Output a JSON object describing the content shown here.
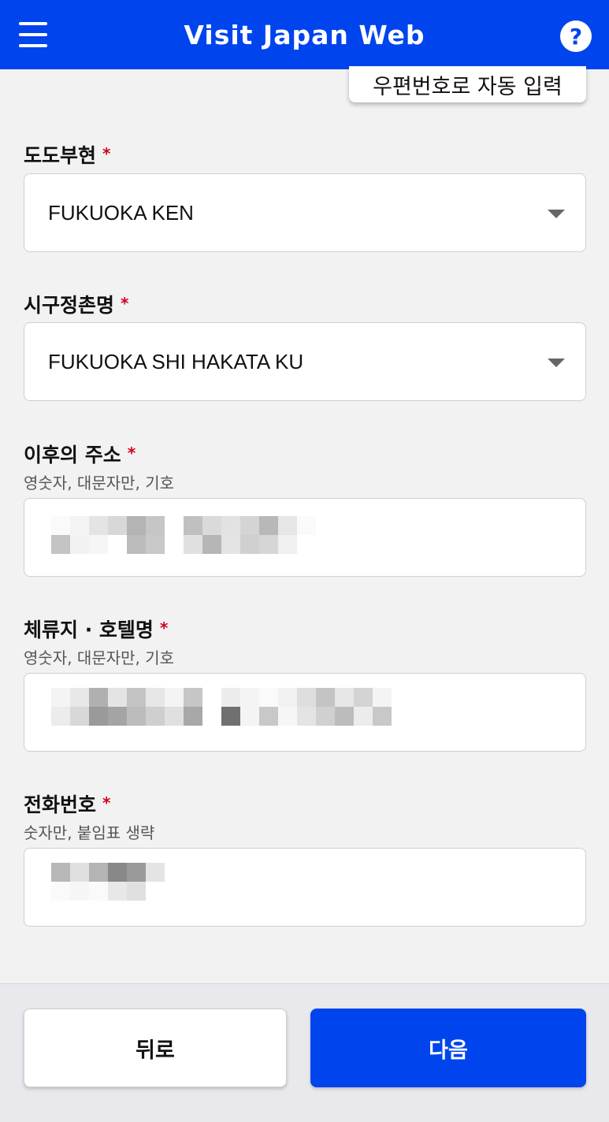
{
  "header": {
    "title": "Visit Japan Web",
    "help_symbol": "?",
    "bg_color": "#0044ee"
  },
  "postal_autofill": {
    "label": "우편번호로 자동 입력"
  },
  "fields": {
    "prefecture": {
      "label": "도도부현",
      "value": "FUKUOKA KEN",
      "required_mark": "*"
    },
    "city": {
      "label": "시구정촌명",
      "value": "FUKUOKA SHI HAKATA KU",
      "required_mark": "*"
    },
    "address": {
      "label": "이후의 주소",
      "hint": "영숫자, 대문자만, 기호",
      "required_mark": "*"
    },
    "hotel": {
      "label": "체류지 · 호텔명",
      "hint": "영숫자, 대문자만, 기호",
      "required_mark": "*"
    },
    "phone": {
      "label": "전화번호",
      "hint": "숫자만, 붙임표 생략",
      "required_mark": "*"
    }
  },
  "footer": {
    "back_label": "뒤로",
    "next_label": "다음"
  }
}
